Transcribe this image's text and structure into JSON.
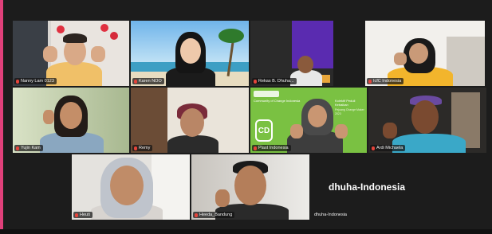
{
  "meeting": {
    "empty_tile_label": "dhuha-Indonesia"
  },
  "participants": [
    {
      "name": "Nanny Lam 0123"
    },
    {
      "name": "Karen NOO"
    },
    {
      "name": "Rekas B. Dhuha..."
    },
    {
      "name": "IcfC Indonesia"
    },
    {
      "name": "Yujin Kam"
    },
    {
      "name": "Remy"
    },
    {
      "name": "Plast Indonesia"
    },
    {
      "name": "Ardi Michaela"
    },
    {
      "name": "Heuti"
    },
    {
      "name": "Heeda_Bandung"
    },
    {
      "name": "dhuha-Indonesia"
    }
  ],
  "slide_text": {
    "logo_letters": "CD",
    "brand": "Community of Change Indonesia",
    "title": "Kolektif Peduli Kebaikan",
    "subtitle": "Pejuang Change Maker 2023"
  },
  "colors": {
    "active_speaker": "#35c28a",
    "muted_mic": "#e5443b",
    "slide_green": "#7ac142"
  }
}
